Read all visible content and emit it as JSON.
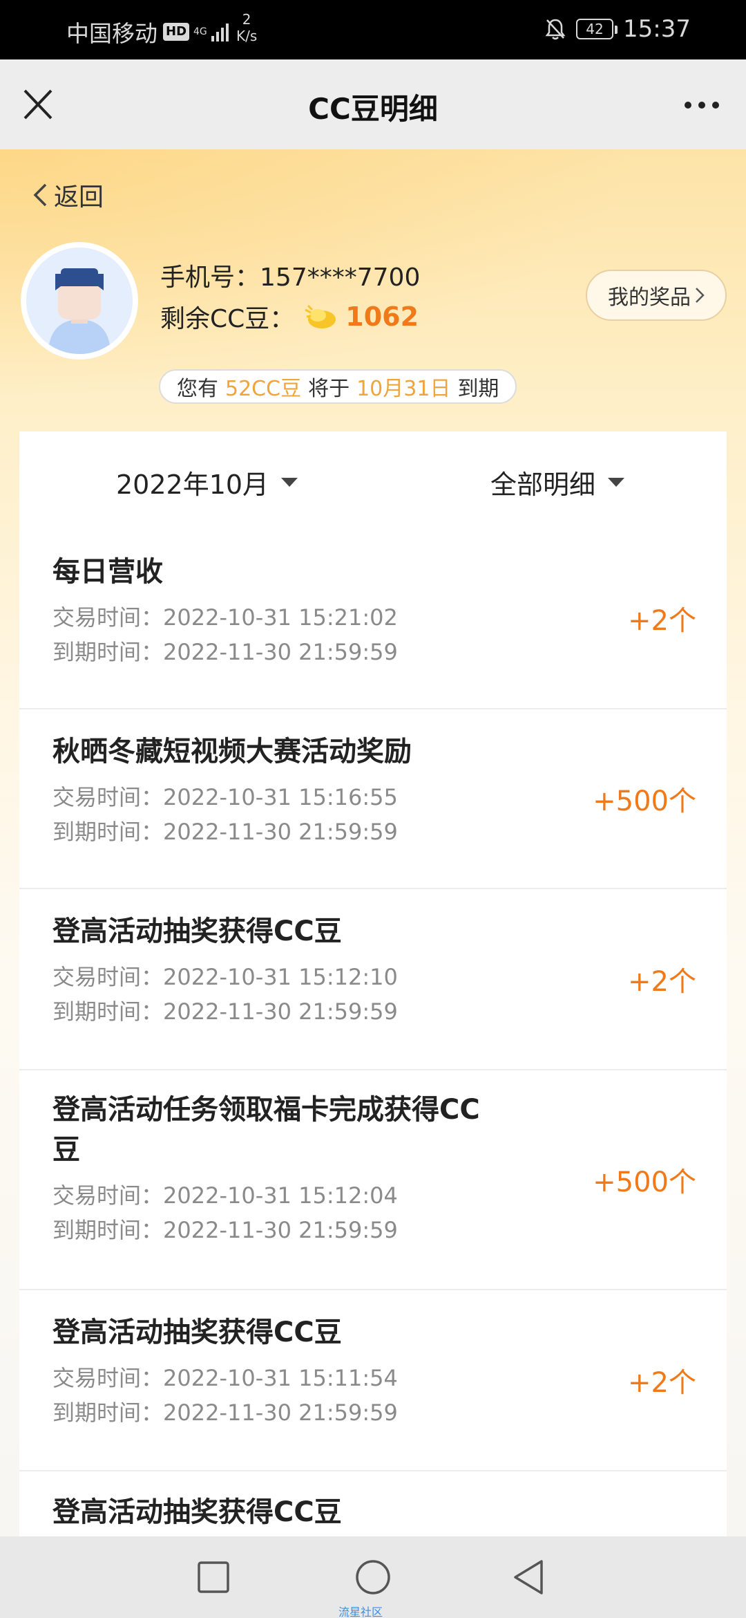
{
  "status_bar": {
    "carrier": "中国移动",
    "hd": "HD",
    "network": "4G",
    "speed_value": "2",
    "speed_unit": "K/s",
    "battery": "42",
    "time": "15:37"
  },
  "title_bar": {
    "title": "CC豆明细"
  },
  "header": {
    "back_label": "返回",
    "phone_label": "手机号：",
    "phone_number": "157****7700",
    "beans_label": "剩余CC豆：",
    "beans_balance": "1062",
    "prizes_label": "我的奖品",
    "expiry": {
      "prefix": "您有",
      "amount": "52CC豆",
      "middle": "将于",
      "date": "10月31日",
      "suffix": "到期"
    }
  },
  "filters": {
    "month": "2022年10月",
    "type": "全部明细"
  },
  "records": [
    {
      "name": "每日营收",
      "trade_label": "交易时间：",
      "trade_time": "2022-10-31 15:21:02",
      "expire_label": "到期时间：",
      "expire_time": "2022-11-30 21:59:59",
      "amount": "+2个"
    },
    {
      "name": "秋晒冬藏短视频大赛活动奖励",
      "trade_label": "交易时间：",
      "trade_time": "2022-10-31 15:16:55",
      "expire_label": "到期时间：",
      "expire_time": "2022-11-30 21:59:59",
      "amount": "+500个"
    },
    {
      "name": "登高活动抽奖获得CC豆",
      "trade_label": "交易时间：",
      "trade_time": "2022-10-31 15:12:10",
      "expire_label": "到期时间：",
      "expire_time": "2022-11-30 21:59:59",
      "amount": "+2个"
    },
    {
      "name": "登高活动任务领取福卡完成获得CC豆",
      "trade_label": "交易时间：",
      "trade_time": "2022-10-31 15:12:04",
      "expire_label": "到期时间：",
      "expire_time": "2022-11-30 21:59:59",
      "amount": "+500个"
    },
    {
      "name": "登高活动抽奖获得CC豆",
      "trade_label": "交易时间：",
      "trade_time": "2022-10-31 15:11:54",
      "expire_label": "到期时间：",
      "expire_time": "2022-11-30 21:59:59",
      "amount": "+2个"
    },
    {
      "name": "登高活动抽奖获得CC豆"
    }
  ],
  "nav_bar": {
    "watermark": "流星社区"
  },
  "colors": {
    "accent": "#f07a19",
    "highlight": "#f0a43c"
  }
}
